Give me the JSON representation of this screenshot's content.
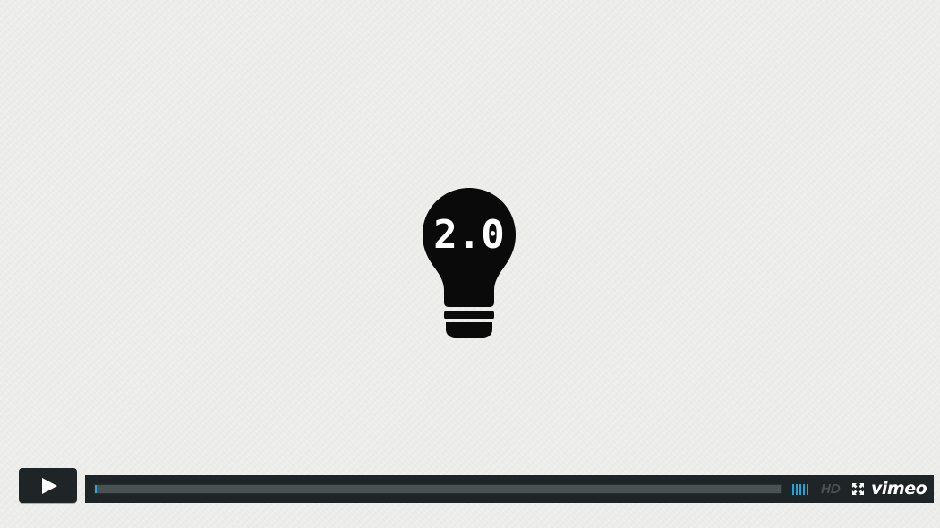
{
  "video": {
    "bulb_text": "2.0",
    "state": "paused"
  },
  "controls": {
    "play_icon": "play-icon",
    "progress": {
      "played_fraction": 0.002,
      "loaded_fraction": 0.0
    },
    "volume": {
      "level_fraction": 1.0,
      "bar_count": 5
    },
    "hd_label": "HD",
    "fullscreen_icon": "fullscreen-icon",
    "brand_label": "vimeo"
  },
  "colors": {
    "accent": "#1fa7da",
    "bar_background": "#1f2527",
    "hd_inactive": "#4b5254"
  }
}
